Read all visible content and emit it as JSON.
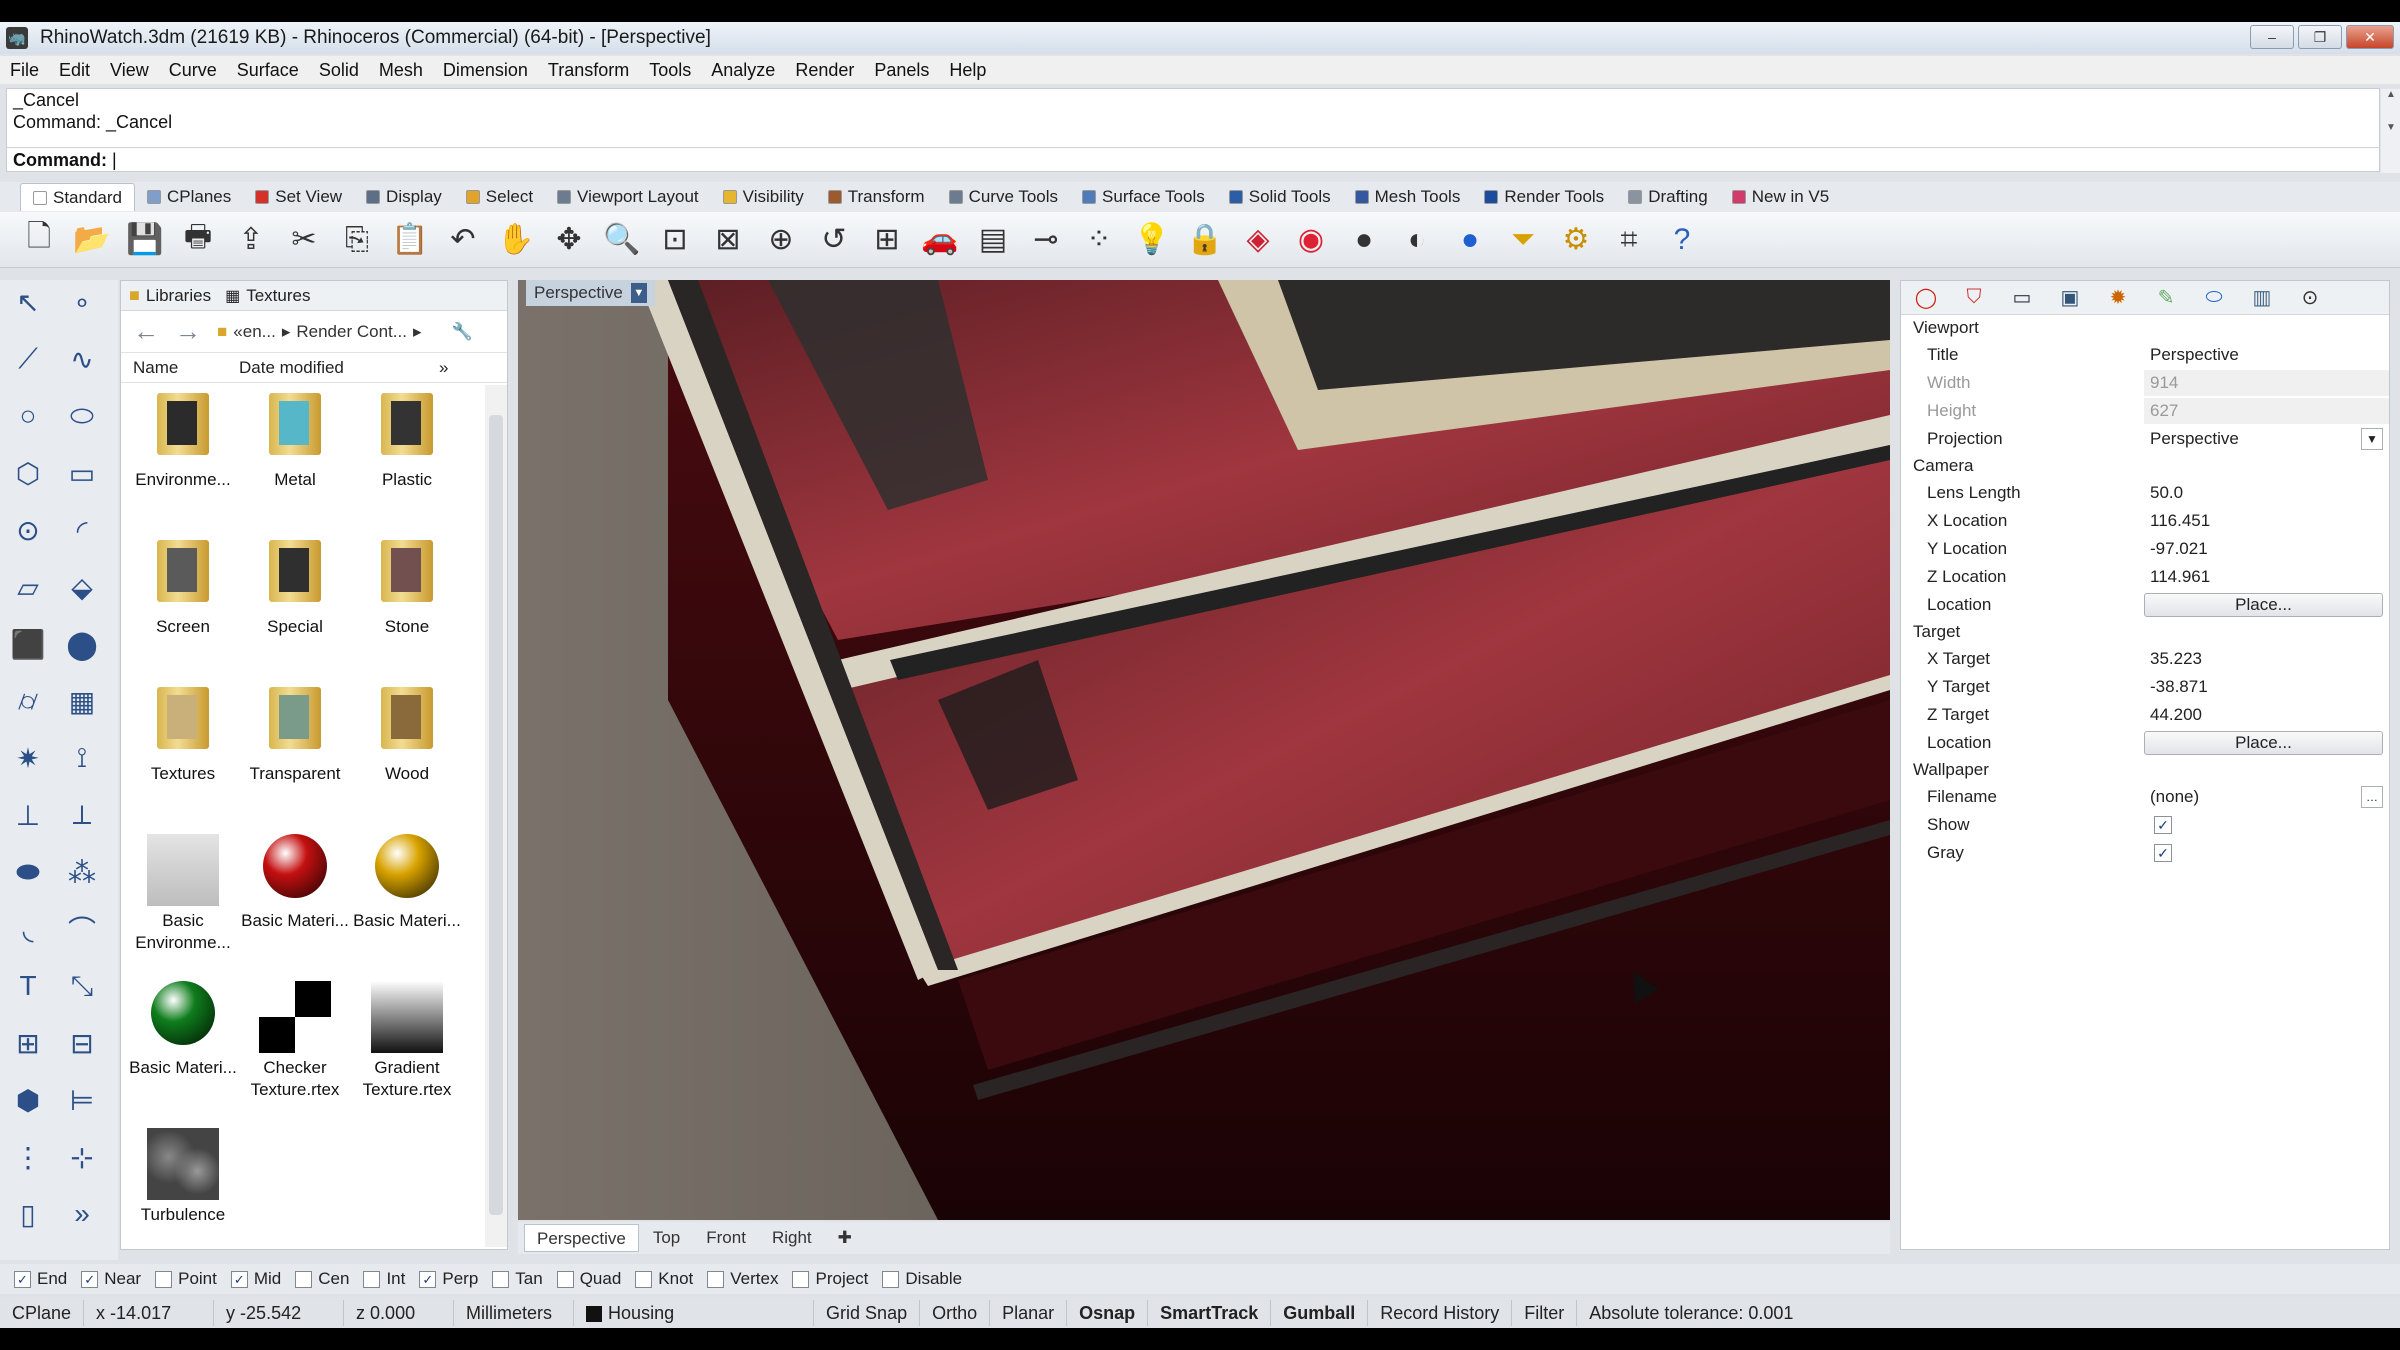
{
  "window": {
    "title": "RhinoWatch.3dm (21619 KB) - Rhinoceros (Commercial) (64-bit) - [Perspective]"
  },
  "menu": [
    "File",
    "Edit",
    "View",
    "Curve",
    "Surface",
    "Solid",
    "Mesh",
    "Dimension",
    "Transform",
    "Tools",
    "Analyze",
    "Render",
    "Panels",
    "Help"
  ],
  "command": {
    "history": [
      "_Cancel",
      "Command: _Cancel"
    ],
    "prompt": "Command:"
  },
  "tabs": [
    {
      "label": "Standard",
      "color": "#ffffff"
    },
    {
      "label": "CPlanes",
      "color": "#7f9ec9"
    },
    {
      "label": "Set View",
      "color": "#d4312b"
    },
    {
      "label": "Display",
      "color": "#5d6f86"
    },
    {
      "label": "Select",
      "color": "#e0a42a"
    },
    {
      "label": "Viewport Layout",
      "color": "#6b7c90"
    },
    {
      "label": "Visibility",
      "color": "#e6b62e"
    },
    {
      "label": "Transform",
      "color": "#9c5b2e"
    },
    {
      "label": "Curve Tools",
      "color": "#6b7c90"
    },
    {
      "label": "Surface Tools",
      "color": "#4f7bb8"
    },
    {
      "label": "Solid Tools",
      "color": "#2c5ea8"
    },
    {
      "label": "Mesh Tools",
      "color": "#3557a0"
    },
    {
      "label": "Render Tools",
      "color": "#1c4d9c"
    },
    {
      "label": "Drafting",
      "color": "#8a94a0"
    },
    {
      "label": "New in V5",
      "color": "#d23a6b"
    }
  ],
  "toolbar_icons": [
    "new-file-icon",
    "open-folder-icon",
    "save-icon",
    "print-icon",
    "export-icon",
    "cut-icon",
    "copy-icon",
    "paste-icon",
    "undo-icon",
    "pan-hand-icon",
    "rotate-view-icon",
    "zoom-in-icon",
    "zoom-window-icon",
    "zoom-extents-icon",
    "zoom-selected-icon",
    "undo-view-icon",
    "four-viewports-icon",
    "car-icon",
    "grid-plane-icon",
    "osnap-icon",
    "points-icon",
    "light-bulb-icon",
    "lock-icon",
    "material-icon",
    "color-wheel-icon",
    "sphere-shaded-icon",
    "sphere-rendered-icon",
    "sphere-blue-icon",
    "funnel-icon",
    "gear-cog-icon",
    "dimension-icon",
    "help-icon"
  ],
  "library": {
    "tabs": [
      "Libraries",
      "Textures"
    ],
    "breadcrumb": [
      "«en...",
      "Render Cont..."
    ],
    "columns": [
      "Name",
      "Date modified"
    ],
    "items": [
      {
        "label": "Environme...",
        "kind": "folder",
        "inner": "#2b2b2b"
      },
      {
        "label": "Metal",
        "kind": "folder",
        "inner": "#56b7c9"
      },
      {
        "label": "Plastic",
        "kind": "folder",
        "inner": "#333333"
      },
      {
        "label": "Screen",
        "kind": "folder",
        "inner": "#5a5a5a"
      },
      {
        "label": "Special",
        "kind": "folder",
        "inner": "#2f2f2f"
      },
      {
        "label": "Stone",
        "kind": "folder",
        "inner": "#735050"
      },
      {
        "label": "Textures",
        "kind": "folder",
        "inner": "#c9b07a"
      },
      {
        "label": "Transparent",
        "kind": "folder",
        "inner": "#7a9a8a"
      },
      {
        "label": "Wood",
        "kind": "folder",
        "inner": "#8a6a3a"
      },
      {
        "label": "Basic Environme...",
        "kind": "env",
        "color": "#d0d0d0"
      },
      {
        "label": "Basic Materi...",
        "kind": "ball",
        "color": "#c41010"
      },
      {
        "label": "Basic Materi...",
        "kind": "ball",
        "color": "#d8a300"
      },
      {
        "label": "Basic Materi...",
        "kind": "ball",
        "color": "#0f7d1d"
      },
      {
        "label": "Checker Texture.rtex",
        "kind": "checker",
        "color": "#000000"
      },
      {
        "label": "Gradient Texture.rtex",
        "kind": "gradient",
        "color": "#111111"
      },
      {
        "label": "Turbulence",
        "kind": "noise",
        "color": "#444444"
      }
    ]
  },
  "viewport": {
    "label": "Perspective",
    "tabs": [
      "Perspective",
      "Top",
      "Front",
      "Right"
    ]
  },
  "properties": {
    "icons": [
      "object-color-icon",
      "material-shield-icon",
      "display-monitor-icon",
      "viewport-icon",
      "sun-icon",
      "pen-icon",
      "ground-plane-icon",
      "light-icon",
      "camera-icon"
    ],
    "viewport": {
      "section": "Viewport",
      "title_k": "Title",
      "title_v": "Perspective",
      "width_k": "Width",
      "width_v": "914",
      "height_k": "Height",
      "height_v": "627",
      "projection_k": "Projection",
      "projection_v": "Perspective"
    },
    "camera": {
      "section": "Camera",
      "lens_k": "Lens Length",
      "lens_v": "50.0",
      "x_k": "X Location",
      "x_v": "116.451",
      "y_k": "Y Location",
      "y_v": "-97.021",
      "z_k": "Z Location",
      "z_v": "114.961",
      "loc_k": "Location",
      "loc_btn": "Place..."
    },
    "target": {
      "section": "Target",
      "x_k": "X Target",
      "x_v": "35.223",
      "y_k": "Y Target",
      "y_v": "-38.871",
      "z_k": "Z Target",
      "z_v": "44.200",
      "loc_k": "Location",
      "loc_btn": "Place..."
    },
    "wallpaper": {
      "section": "Wallpaper",
      "file_k": "Filename",
      "file_v": "(none)",
      "show_k": "Show",
      "show_checked": true,
      "gray_k": "Gray",
      "gray_checked": true,
      "check_mark": "✓"
    }
  },
  "osnaps": [
    {
      "label": "End",
      "checked": true
    },
    {
      "label": "Near",
      "checked": true
    },
    {
      "label": "Point",
      "checked": false
    },
    {
      "label": "Mid",
      "checked": true
    },
    {
      "label": "Cen",
      "checked": false
    },
    {
      "label": "Int",
      "checked": false
    },
    {
      "label": "Perp",
      "checked": true
    },
    {
      "label": "Tan",
      "checked": false
    },
    {
      "label": "Quad",
      "checked": false
    },
    {
      "label": "Knot",
      "checked": false
    },
    {
      "label": "Vertex",
      "checked": false
    },
    {
      "label": "Project",
      "checked": false
    },
    {
      "label": "Disable",
      "checked": false
    }
  ],
  "status": {
    "cplane": "CPlane",
    "x": "x -14.017",
    "y": "y -25.542",
    "z": "z 0.000",
    "units": "Millimeters",
    "layer": "Housing",
    "gridsnap": "Grid Snap",
    "ortho": "Ortho",
    "planar": "Planar",
    "osnap": "Osnap",
    "smarttrack": "SmartTrack",
    "gumball": "Gumball",
    "record": "Record History",
    "filter": "Filter",
    "tolerance": "Absolute tolerance: 0.001"
  }
}
